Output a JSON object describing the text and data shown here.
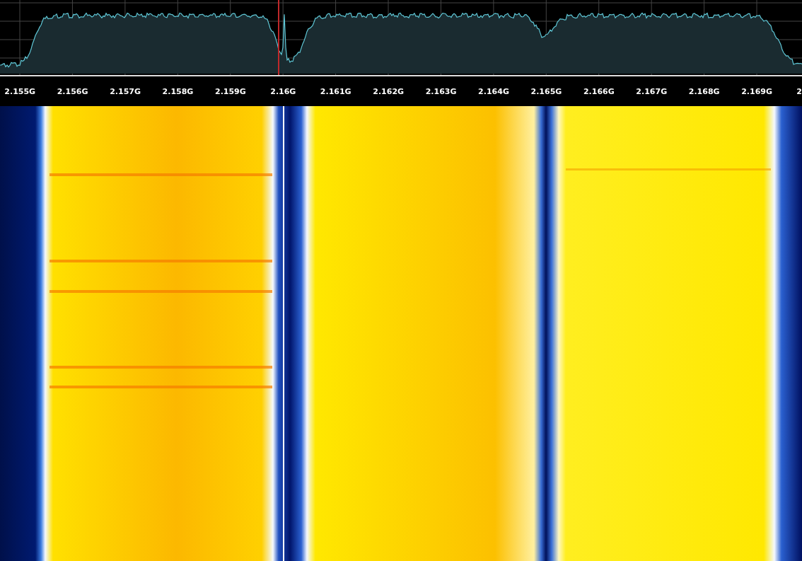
{
  "frequency_axis": {
    "labels": [
      "2.155G",
      "2.156G",
      "2.157G",
      "2.158G",
      "2.159G",
      "2.16G",
      "2.161G",
      "2.162G",
      "2.163G",
      "2.164G",
      "2.165G",
      "2.166G",
      "2.167G",
      "2.168G",
      "2.169G",
      "2"
    ]
  }
}
